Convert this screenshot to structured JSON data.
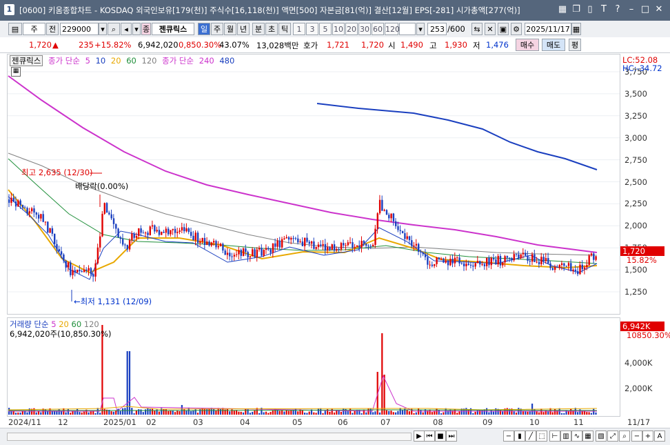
{
  "title_bar": {
    "window_num": "1",
    "title": "[0600] 키움종합차트 - KOSDAQ 외국인보유[179(천)] 주식수[16,118(천)] 액면[500] 자본금[81(억)] 결산[12월] EPS[-281] 시가총액[277(억)]"
  },
  "toolbar": {
    "period_label": "주",
    "prev_label": "전",
    "code": "229000",
    "stock_label": "젠큐릭스",
    "stock_tag": "종",
    "period_buttons": [
      "일",
      "주",
      "월",
      "년",
      "분",
      "초",
      "틱"
    ],
    "interval_buttons": [
      "1",
      "3",
      "5",
      "10",
      "20",
      "30",
      "60",
      "120"
    ],
    "count": "253",
    "count_total": "/600",
    "date": "2025/11/17"
  },
  "quote": {
    "price": "1,720",
    "change": "235",
    "change_pct": "+15.82%",
    "volume": "6,942,020",
    "vol_ratio": "0,850.30%",
    "turnover": "43.07%",
    "amount": "13,028백만",
    "ask_label": "호가",
    "ask1": "1,721",
    "ask2": "1,720",
    "open_label": "시",
    "open": "1,490",
    "high_label": "고",
    "high": "1,930",
    "low_label": "저",
    "low": "1,476",
    "buy_label": "매수",
    "sell_label": "매도",
    "eval_label": "평"
  },
  "legend": {
    "stock": "젠큐릭스",
    "ma_label": "종가 단순",
    "ma1": "5",
    "ma2": "10",
    "ma3": "20",
    "ma4": "60",
    "ma5": "120",
    "ma_label2": "종가 단순",
    "ma6": "240",
    "ma7": "480"
  },
  "annotations": {
    "high_note": "최고 2,635 (12/30)",
    "div_note": "배당락(0.00%)",
    "low_note": "←최저 1,131 (12/09)"
  },
  "right_tags": {
    "lc": "LC:52.08",
    "hc": "HC:-34.72",
    "price": "1,720",
    "pct": "15.82%",
    "vol": "6,942K",
    "vol_pct": "10850.30%"
  },
  "price_axis": [
    "3,750",
    "3,500",
    "3,250",
    "3,000",
    "2,750",
    "2,500",
    "2,250",
    "2,000",
    "1,750",
    "1,500",
    "1,250"
  ],
  "volume_axis": [
    "4,000K",
    "2,000K"
  ],
  "volume_legend": {
    "label": "거래량 단순",
    "ma1": "5",
    "ma2": "20",
    "ma3": "60",
    "ma4": "120",
    "value": "6,942,020주(10,850.30%)"
  },
  "x_axis": [
    "2024/11",
    "12",
    "2025/01",
    "02",
    "03",
    "04",
    "05",
    "06",
    "07",
    "08",
    "09",
    "10",
    "11",
    "11/17"
  ],
  "colors": {
    "up": "#e00000",
    "down": "#1a3fbf",
    "ma5": "#1a3fbf",
    "ma10": "#1a3fbf",
    "ma20": "#e8a800",
    "ma60": "#1f8f3a",
    "ma120": "#808080",
    "ma240": "#cc33cc",
    "ma480": "#1a3fbf"
  }
}
